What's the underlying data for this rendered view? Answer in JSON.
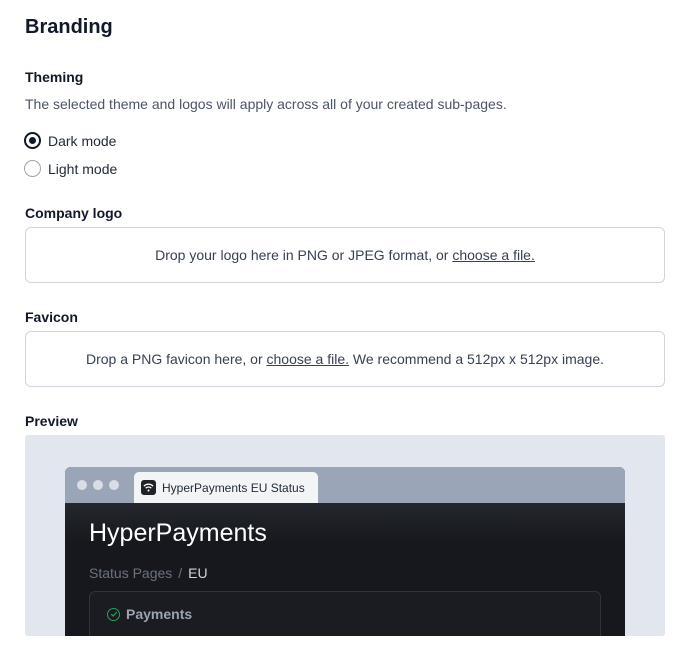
{
  "page": {
    "title": "Branding"
  },
  "theming": {
    "label": "Theming",
    "description": "The selected theme and logos will apply across all of your created sub-pages.",
    "options": [
      {
        "label": "Dark mode",
        "selected": true
      },
      {
        "label": "Light mode",
        "selected": false
      }
    ]
  },
  "company_logo": {
    "label": "Company logo",
    "drop_text": "Drop your logo here in PNG or JPEG format, or ",
    "link_text": "choose a file."
  },
  "favicon": {
    "label": "Favicon",
    "drop_text_before": "Drop a PNG favicon here, or ",
    "link_text": "choose a file.",
    "drop_text_after": " We recommend a 512px x 512px image."
  },
  "preview": {
    "label": "Preview",
    "tab_title": "HyperPayments EU Status",
    "brand_name": "HyperPayments",
    "breadcrumb": {
      "parent": "Status Pages",
      "separator": "/",
      "current": "EU"
    },
    "component": {
      "name": "Payments",
      "status_icon": "check-circle-icon",
      "status_color": "#22a35a"
    },
    "tab_icon": "wifi-icon"
  }
}
